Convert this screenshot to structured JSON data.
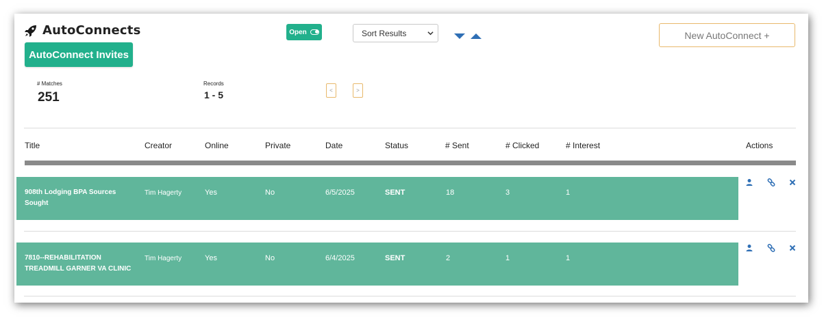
{
  "header": {
    "title": "AutoConnects",
    "invites_label": "AutoConnect Invites",
    "open_label": "Open",
    "sort_placeholder": "Sort Results",
    "new_label": "New AutoConnect +"
  },
  "stats": {
    "matches_label": "# Matches",
    "matches_value": "251",
    "records_label": "Records",
    "records_value": "1 - 5",
    "prev_label": "<",
    "next_label": ">"
  },
  "table": {
    "columns": [
      "Title",
      "Creator",
      "Online",
      "Private",
      "Date",
      "Status",
      "# Sent",
      "# Clicked",
      "# Interest",
      "Actions"
    ],
    "rows": [
      {
        "title_line1": "908th Lodging BPA Sources",
        "title_line2": "Sought",
        "creator": "Tim Hagerty",
        "online": "Yes",
        "private": "No",
        "date": "6/5/2025",
        "status": "SENT",
        "sent": "18",
        "clicked": "3",
        "interest": "1"
      },
      {
        "title_line1": "7810--REHABILITATION",
        "title_line2": "TREADMILL GARNER VA CLINIC",
        "creator": "Tim Hagerty",
        "online": "Yes",
        "private": "No",
        "date": "6/4/2025",
        "status": "SENT",
        "sent": "2",
        "clicked": "1",
        "interest": "1"
      }
    ]
  },
  "icons": [
    "rocket-icon",
    "toggle-icon",
    "caret-down-icon",
    "caret-up-icon",
    "user-icon",
    "link-icon",
    "close-icon"
  ],
  "colors": {
    "accent": "#22b08c",
    "row_bg": "#60b69b",
    "action_icon": "#2f6fb5",
    "new_button_border": "#e8b86a"
  }
}
